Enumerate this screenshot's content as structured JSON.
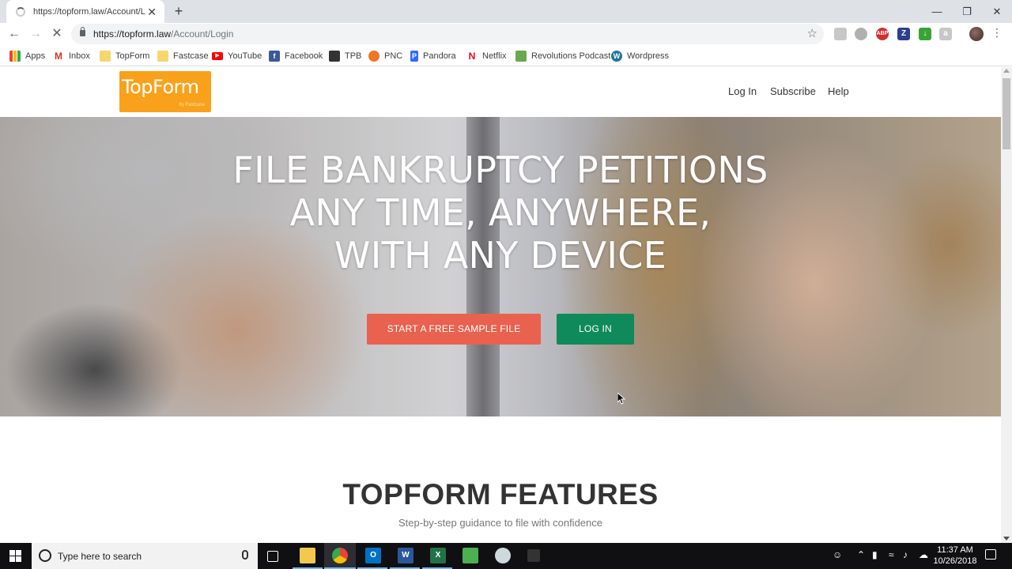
{
  "browser": {
    "tab_title": "https://topform.law/Account/Login",
    "new_tab": "+",
    "tab_close": "✕",
    "url_host": "https://topform.law",
    "url_path": "/Account/Login",
    "window": {
      "minimize": "—",
      "restore": "❐",
      "close": "✕"
    }
  },
  "bookmarks": [
    {
      "label": "Apps",
      "icon": "apps-grid-icon",
      "color": "#5f6368"
    },
    {
      "label": "Inbox",
      "icon": "gmail-icon",
      "color": "#d93025"
    },
    {
      "label": "TopForm",
      "icon": "folder-icon",
      "color": "#f5d76e"
    },
    {
      "label": "Fastcase",
      "icon": "folder-icon",
      "color": "#f5d76e"
    },
    {
      "label": "YouTube",
      "icon": "youtube-icon",
      "color": "#ff0000"
    },
    {
      "label": "Facebook",
      "icon": "facebook-icon",
      "color": "#3b5998"
    },
    {
      "label": "TPB",
      "icon": "tpb-icon",
      "color": "#333333"
    },
    {
      "label": "PNC",
      "icon": "pnc-icon",
      "color": "#ef7622"
    },
    {
      "label": "Pandora",
      "icon": "pandora-icon",
      "color": "#3668ff"
    },
    {
      "label": "Netflix",
      "icon": "netflix-icon",
      "color": "#e50914"
    },
    {
      "label": "Revolutions Podcast",
      "icon": "podcast-icon",
      "color": "#6aa84f"
    },
    {
      "label": "Wordpress",
      "icon": "wordpress-icon",
      "color": "#21759b"
    }
  ],
  "site": {
    "logo_text": "TopForm",
    "logo_sub": "by Fastcase",
    "logo_color": "#f9a11b",
    "nav": [
      "Log In",
      "Subscribe",
      "Help"
    ]
  },
  "hero": {
    "title_lines": [
      "FILE BANKRUPTCY PETITIONS",
      "ANY TIME, ANYWHERE,",
      "WITH ANY DEVICE"
    ],
    "cta_sample": "START A FREE SAMPLE FILE",
    "cta_login": "LOG IN",
    "cta_sample_color": "#e8624f",
    "cta_login_color": "#0f8a5a"
  },
  "features": {
    "title": "TOPFORM FEATURES",
    "subtitle": "Step-by-step guidance to file with confidence"
  },
  "taskbar": {
    "search_placeholder": "Type here to search",
    "time": "11:37 AM",
    "date": "10/26/2018"
  }
}
